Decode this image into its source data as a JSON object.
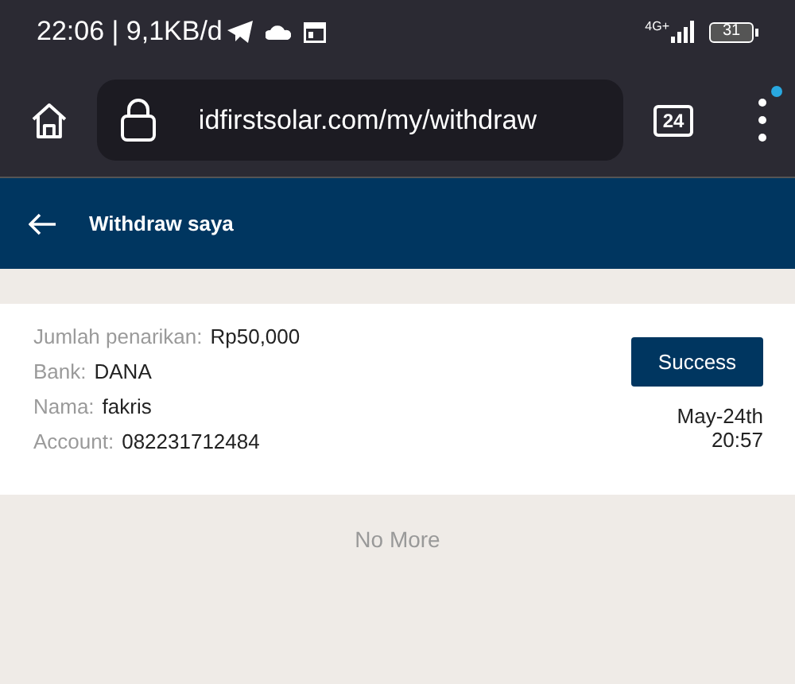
{
  "status_bar": {
    "time": "22:06 | 9,1KB/d",
    "network": "4G+",
    "battery": "31"
  },
  "browser": {
    "url": "idfirstsolar.com/my/withdraw",
    "tab_count": "24",
    "has_notification": true
  },
  "header": {
    "title": "Withdraw saya"
  },
  "withdrawals": [
    {
      "fields": [
        {
          "label": "Jumlah penarikan:",
          "value": "Rp50,000"
        },
        {
          "label": "Bank:",
          "value": "DANA"
        },
        {
          "label": "Nama:",
          "value": "fakris"
        },
        {
          "label": "Account:",
          "value": "082231712484"
        }
      ],
      "status": "Success",
      "date": "May-24th",
      "time": "20:57"
    }
  ],
  "footer": "No More"
}
